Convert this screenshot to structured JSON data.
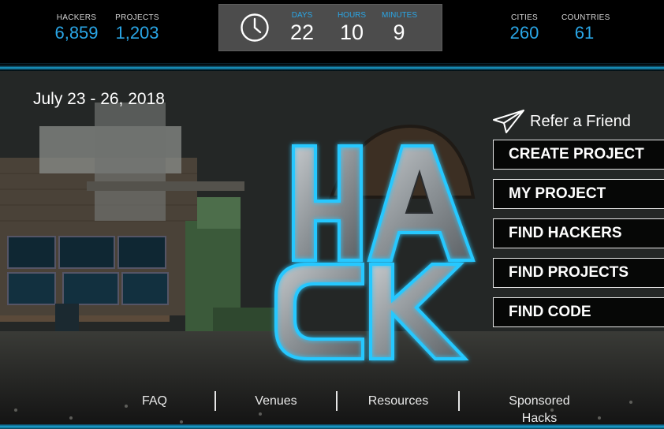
{
  "stats": {
    "hackers": {
      "label": "HACKERS",
      "value": "6,859"
    },
    "projects": {
      "label": "PROJECTS",
      "value": "1,203"
    },
    "cities": {
      "label": "CITIES",
      "value": "260"
    },
    "countries": {
      "label": "COUNTRIES",
      "value": "61"
    }
  },
  "countdown": {
    "icon": "clock-icon",
    "days": {
      "label": "DAYS",
      "value": "22"
    },
    "hours": {
      "label": "HOURS",
      "value": "10"
    },
    "minutes": {
      "label": "MINUTES",
      "value": "9"
    }
  },
  "hero": {
    "date": "July 23 - 26, 2018",
    "refer": {
      "icon": "paper-plane-icon",
      "label": "Refer a Friend"
    },
    "buttons": [
      {
        "label": "CREATE PROJECT"
      },
      {
        "label": "MY PROJECT"
      },
      {
        "label": "FIND HACKERS"
      },
      {
        "label": "FIND PROJECTS"
      },
      {
        "label": "FIND CODE"
      }
    ],
    "logo_text": "HACK"
  },
  "footer": {
    "links": [
      {
        "label": "FAQ"
      },
      {
        "label": "Venues"
      },
      {
        "label": "Resources"
      },
      {
        "label": "Sponsored"
      },
      {
        "label": "Hacks"
      }
    ]
  },
  "colors": {
    "accent": "#2aa6e6",
    "neon": "#27c8ff",
    "background": "#000000",
    "countdown_panel": "#4c4c4c"
  }
}
